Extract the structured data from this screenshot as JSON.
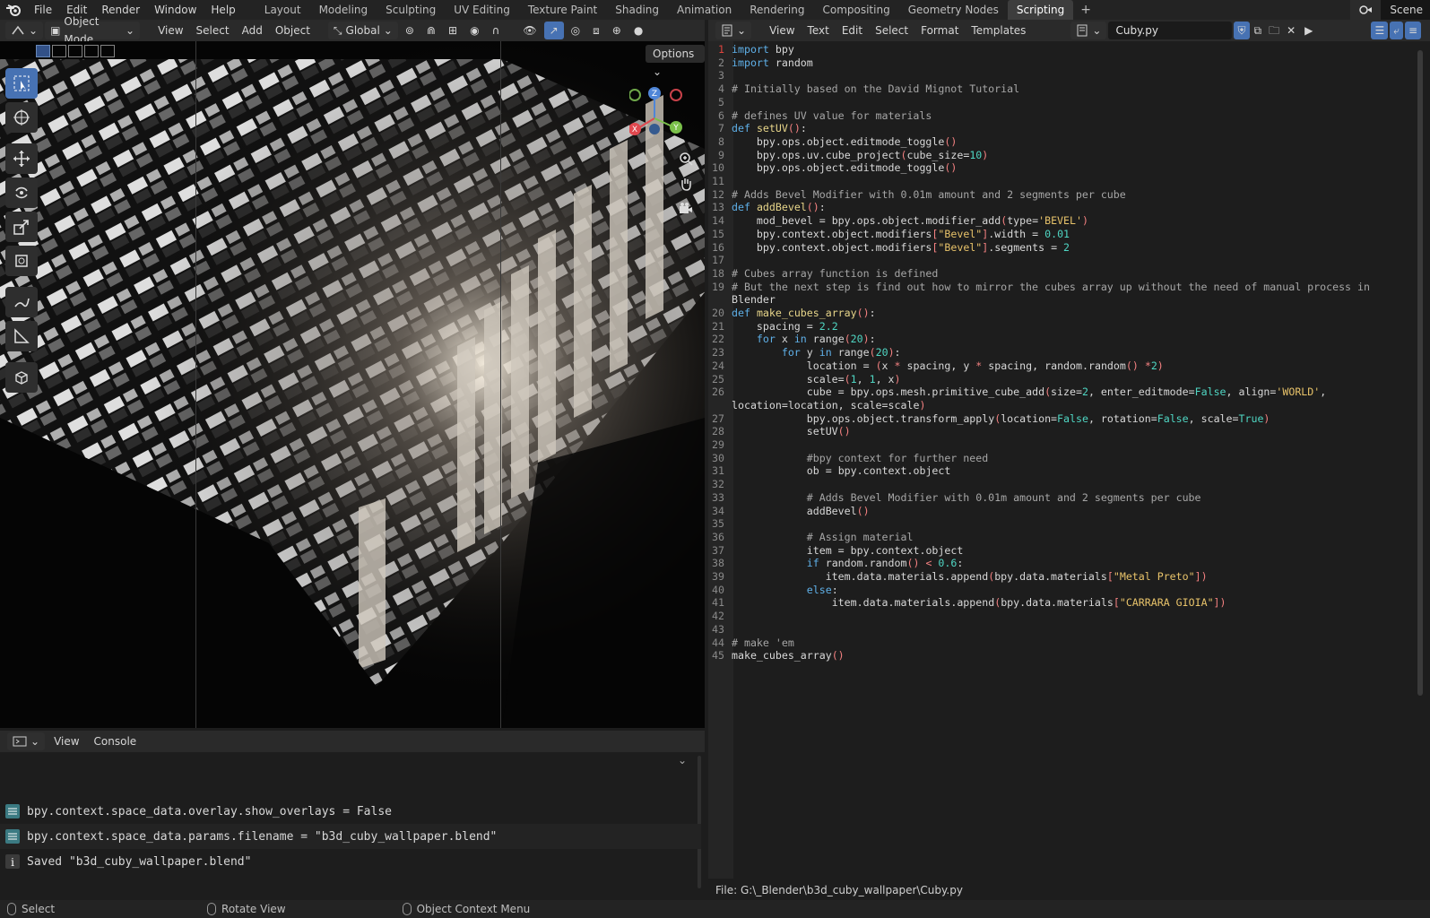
{
  "menus": [
    "File",
    "Edit",
    "Render",
    "Window",
    "Help"
  ],
  "workspaces": [
    "Layout",
    "Modeling",
    "Sculpting",
    "UV Editing",
    "Texture Paint",
    "Shading",
    "Animation",
    "Rendering",
    "Compositing",
    "Geometry Nodes",
    "Scripting"
  ],
  "active_workspace": "Scripting",
  "scene_label": "Scene",
  "viewport": {
    "mode": "Object Mode",
    "menus": [
      "View",
      "Select",
      "Add",
      "Object"
    ],
    "orientation": "Global",
    "options_label": "Options",
    "gizmo": {
      "x": "X",
      "y": "Y",
      "z": "Z"
    }
  },
  "console": {
    "menus": [
      "View",
      "Console"
    ],
    "lines": [
      "bpy.context.space_data.overlay.show_overlays = False",
      "bpy.context.space_data.params.filename = \"b3d_cuby_wallpaper.blend\"",
      "Saved \"b3d_cuby_wallpaper.blend\""
    ]
  },
  "text_editor": {
    "menus": [
      "View",
      "Text",
      "Edit",
      "Select",
      "Format",
      "Templates"
    ],
    "filename": "Cuby.py",
    "footer": "File: G:\\_Blender\\b3d_cuby_wallpaper\\Cuby.py",
    "line_numbers": [
      "1",
      "2",
      "3",
      "4",
      "5",
      "6",
      "7",
      "8",
      "9",
      "10",
      "11",
      "12",
      "13",
      "14",
      "15",
      "16",
      "17",
      "18",
      "19",
      "",
      "20",
      "21",
      "22",
      "23",
      "24",
      "25",
      "26",
      "",
      "27",
      "28",
      "29",
      "30",
      "31",
      "32",
      "33",
      "34",
      "35",
      "36",
      "37",
      "38",
      "39",
      "40",
      "41",
      "42",
      "43",
      "44",
      "45"
    ],
    "code": [
      "import bpy",
      "import random",
      "",
      "# Initially based on the David Mignot Tutorial",
      "",
      "# defines UV value for materials",
      "def setUV():",
      "    bpy.ops.object.editmode_toggle()",
      "    bpy.ops.uv.cube_project(cube_size=10)",
      "    bpy.ops.object.editmode_toggle()",
      "",
      "# Adds Bevel Modifier with 0.01m amount and 2 segments per cube",
      "def addBevel():",
      "    mod_bevel = bpy.ops.object.modifier_add(type='BEVEL')",
      "    bpy.context.object.modifiers[\"Bevel\"].width = 0.01",
      "    bpy.context.object.modifiers[\"Bevel\"].segments = 2",
      "",
      "# Cubes array function is defined",
      "# But the next step is find out how to mirror the cubes array up without the need of manual process in",
      "Blender",
      "def make_cubes_array():",
      "    spacing = 2.2",
      "    for x in range(20):",
      "        for y in range(20):",
      "            location = (x * spacing, y * spacing, random.random() *2)",
      "            scale=(1, 1, x)",
      "            cube = bpy.ops.mesh.primitive_cube_add(size=2, enter_editmode=False, align='WORLD',",
      "location=location, scale=scale)",
      "            bpy.ops.object.transform_apply(location=False, rotation=False, scale=True)",
      "            setUV()",
      "",
      "            #bpy context for further need",
      "            ob = bpy.context.object",
      "",
      "            # Adds Bevel Modifier with 0.01m amount and 2 segments per cube",
      "            addBevel()",
      "",
      "            # Assign material",
      "            item = bpy.context.object",
      "            if random.random() < 0.6:",
      "               item.data.materials.append(bpy.data.materials[\"Metal Preto\"])",
      "            else:",
      "                item.data.materials.append(bpy.data.materials[\"CARRARA GIOIA\"])",
      "",
      "",
      "# make 'em",
      "make_cubes_array()"
    ]
  },
  "status": {
    "select": "Select",
    "rotate": "Rotate View",
    "context": "Object Context Menu"
  },
  "colors": {
    "accent": "#4772b3",
    "keyword": "#5fb0e8",
    "string": "#e8c36a",
    "number": "#4fd6c3",
    "comment": "#a6a6a6",
    "active_tab": "#3d3d3d"
  }
}
